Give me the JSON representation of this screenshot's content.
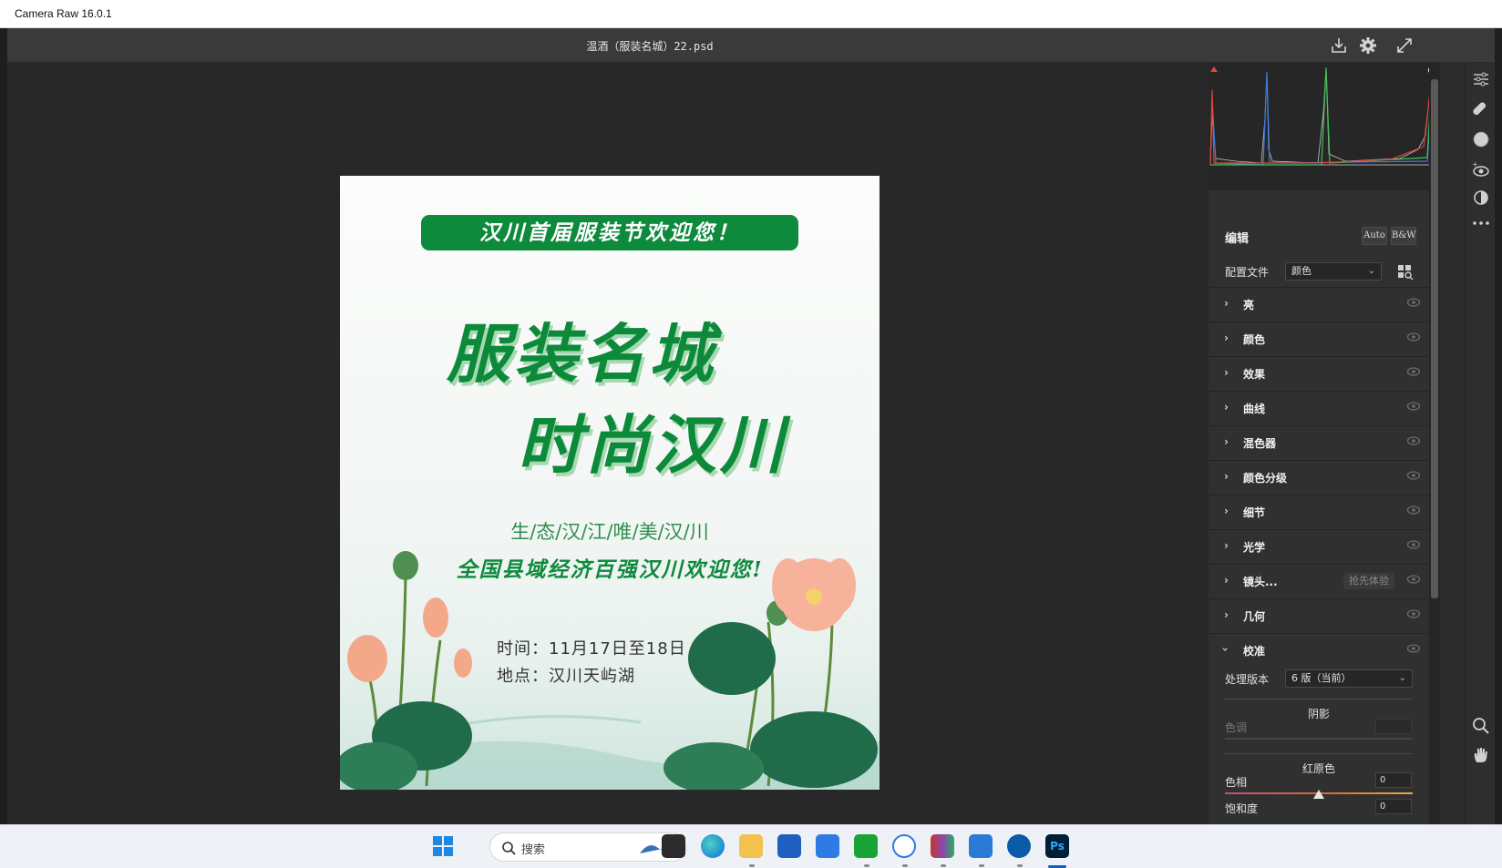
{
  "window": {
    "title": "Camera Raw 16.0.1"
  },
  "toolbar": {
    "document_name": "温酒（服装名城）22.psd",
    "icons": [
      "save-icon",
      "settings-gear-icon",
      "fullscreen-icon"
    ]
  },
  "poster": {
    "banner": "汉川首届服装节欢迎您！",
    "headline_1": "服装名城",
    "headline_2": "时尚汉川",
    "subtitle": "生/态/汉/江/唯/美/汉/川",
    "slogan": "全国县域经济百强汉川欢迎您!",
    "time": "时间：11月17日至18日",
    "place": "地点：汉川天屿湖"
  },
  "panel": {
    "edit_title": "编辑",
    "auto_label": "Auto",
    "bw_label": "B&W",
    "profile_label": "配置文件",
    "profile_value": "颜色",
    "sections": [
      {
        "label": "亮",
        "state": "collapsed"
      },
      {
        "label": "颜色",
        "state": "collapsed"
      },
      {
        "label": "效果",
        "state": "collapsed"
      },
      {
        "label": "曲线",
        "state": "collapsed"
      },
      {
        "label": "混色器",
        "state": "collapsed"
      },
      {
        "label": "颜色分级",
        "state": "collapsed"
      },
      {
        "label": "细节",
        "state": "collapsed"
      },
      {
        "label": "光学",
        "state": "collapsed"
      },
      {
        "label": "镜头...",
        "state": "collapsed",
        "badge": "抢先体验"
      },
      {
        "label": "几何",
        "state": "collapsed"
      },
      {
        "label": "校准",
        "state": "expanded"
      }
    ],
    "calibration": {
      "process_label": "处理版本",
      "process_value": "6 版（当前）",
      "shadows_title": "阴影",
      "tint_label": "色调",
      "red_primary_title": "红原色",
      "hue_label": "色相",
      "hue_value": "0",
      "saturation_label": "饱和度",
      "saturation_value": "0"
    }
  },
  "taskbar": {
    "search_placeholder": "搜索"
  },
  "colors": {
    "accent_green": "#0e8a3d",
    "panel_bg": "#303030",
    "canvas_bg": "#282828"
  }
}
